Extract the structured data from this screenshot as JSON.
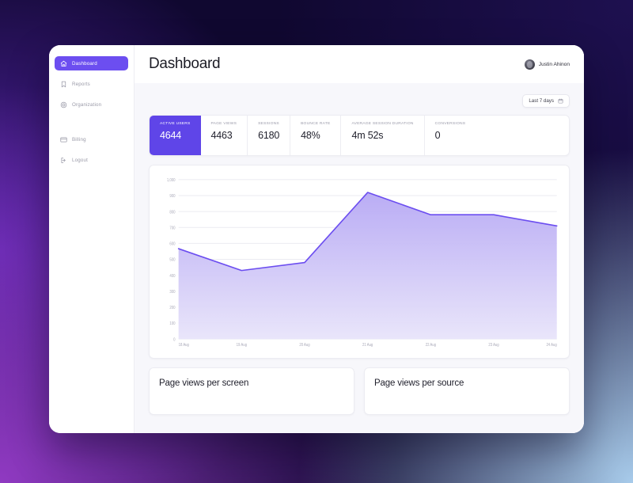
{
  "sidebar": {
    "items": [
      {
        "label": "Dashboard",
        "icon": "home-icon",
        "active": true
      },
      {
        "label": "Reports",
        "icon": "bookmark-icon",
        "active": false
      },
      {
        "label": "Organization",
        "icon": "target-icon",
        "active": false
      },
      {
        "label": "Billing",
        "icon": "credit-card-icon",
        "active": false
      },
      {
        "label": "Logout",
        "icon": "logout-icon",
        "active": false
      }
    ]
  },
  "header": {
    "title": "Dashboard",
    "user_name": "Justin Ahinon",
    "avatar_alt": "Justin Ahinon avatar"
  },
  "filters": {
    "date_range_label": "Last 7 days",
    "date_range_icon": "calendar-icon"
  },
  "stats": [
    {
      "label": "ACTIVE USERS",
      "value": "4644",
      "active": true
    },
    {
      "label": "PAGE VIEWS",
      "value": "4463",
      "active": false
    },
    {
      "label": "SESSIONS",
      "value": "6180",
      "active": false
    },
    {
      "label": "BOUNCE RATE",
      "value": "48%",
      "active": false
    },
    {
      "label": "AVERAGE SESSION DURATION",
      "value": "4m 52s",
      "active": false
    },
    {
      "label": "CONVERSIONS",
      "value": "0",
      "active": false
    }
  ],
  "chart_data": {
    "type": "area",
    "title": "",
    "xlabel": "",
    "ylabel": "",
    "x": [
      "18 Aug",
      "19 Aug",
      "20 Aug",
      "21 Aug",
      "22 Aug",
      "23 Aug",
      "24 Aug"
    ],
    "series": [
      {
        "name": "Active users",
        "values": [
          567,
          430,
          480,
          920,
          780,
          780,
          710
        ]
      }
    ],
    "ylim": [
      0,
      1000
    ],
    "yticks": [
      0,
      100,
      200,
      300,
      400,
      500,
      600,
      700,
      800,
      900,
      1000
    ],
    "ytick_labels": [
      "0",
      "100",
      "200",
      "300",
      "400",
      "500",
      "600",
      "700",
      "800",
      "900",
      "1,000"
    ],
    "grid": true,
    "legend": "none",
    "line_color": "#6b4df0",
    "fill_color_top": "#b6a8f4",
    "fill_color_bottom": "#e8e4fa"
  },
  "bottom_cards": [
    {
      "title": "Page views per screen"
    },
    {
      "title": "Page views per source"
    }
  ],
  "colors": {
    "accent": "#5f45e8",
    "sidebar_active": "#6c4ef0",
    "text_primary": "#1f1f2b",
    "text_muted": "#9b9baa",
    "surface": "#ffffff",
    "canvas": "#f7f7fb"
  }
}
